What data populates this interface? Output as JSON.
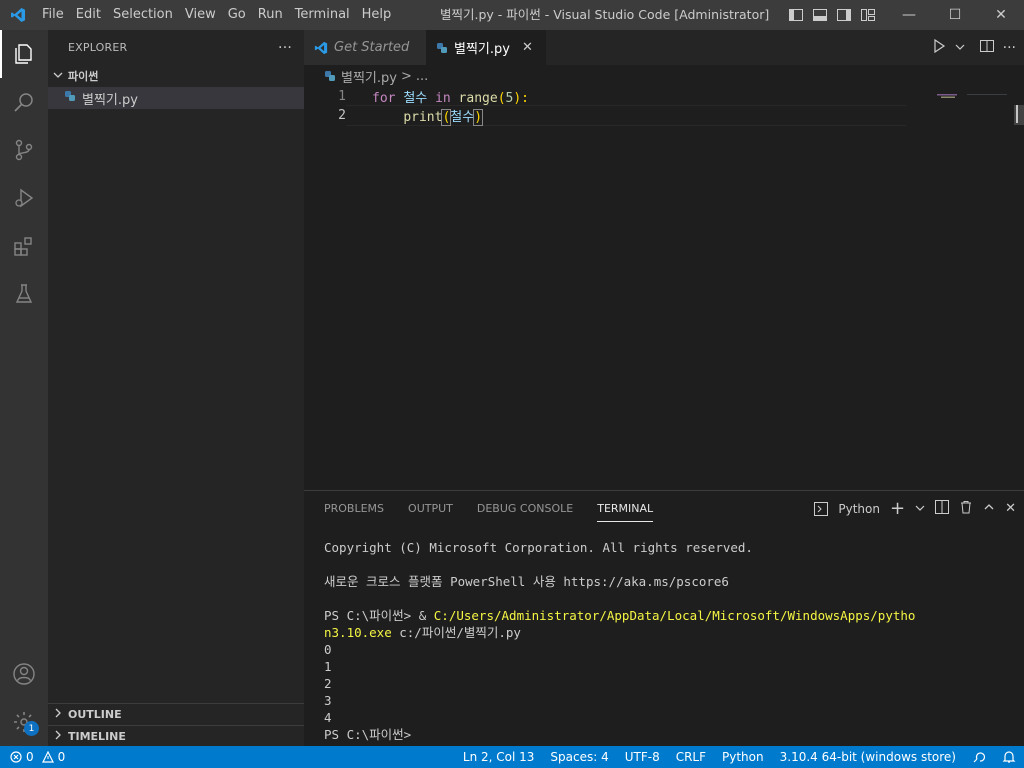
{
  "titlebar": {
    "menu": [
      "File",
      "Edit",
      "Selection",
      "View",
      "Go",
      "Run",
      "Terminal",
      "Help"
    ],
    "title": "별찍기.py - 파이썬 - Visual Studio Code [Administrator]"
  },
  "sidebar": {
    "header": "EXPLORER",
    "more": "···",
    "folder": "파이썬",
    "file": "별찍기.py",
    "outline": "OUTLINE",
    "timeline": "TIMELINE"
  },
  "tabs": [
    {
      "label": "Get Started",
      "active": false
    },
    {
      "label": "별찍기.py",
      "active": true,
      "close": "✕"
    }
  ],
  "breadcrumb": {
    "file": "별찍기.py",
    "sep": ">",
    "rest": "..."
  },
  "code": {
    "line_numbers": [
      "1",
      "2"
    ],
    "line1": {
      "kw1": "for",
      "var1": "철수",
      "kw2": "in",
      "fn": "range",
      "open": "(",
      "num": "5",
      "close": "):"
    },
    "line2": {
      "fn": "print",
      "open": "(",
      "var": "철수",
      "close": ")"
    }
  },
  "panel": {
    "tabs": [
      "PROBLEMS",
      "OUTPUT",
      "DEBUG CONSOLE",
      "TERMINAL"
    ],
    "active_tab": "TERMINAL",
    "shell": "Python",
    "terminal": {
      "l1": "Copyright (C) Microsoft Corporation. All rights reserved.",
      "l2": "새로운 크로스 플랫폼 PowerShell 사용 https://aka.ms/pscore6",
      "prompt": "PS C:\\파이썬> ",
      "amp": "& ",
      "cmd_a": "C:/Users/Administrator/AppData/Local/Microsoft/WindowsApps/pytho",
      "cmd_b": "n3.10.exe",
      "cmd_arg": " c:/파이썬/별찍기.py",
      "outputs": [
        "0",
        "1",
        "2",
        "3",
        "4"
      ],
      "final_prompt": "PS C:\\파이썬>"
    }
  },
  "statusbar": {
    "errors": "0",
    "warnings": "0",
    "position": "Ln 2, Col 13",
    "spaces": "Spaces: 4",
    "encoding": "UTF-8",
    "eol": "CRLF",
    "language": "Python",
    "interpreter": "3.10.4 64-bit (windows store)"
  },
  "activity_badge": "1",
  "colors": {
    "accent": "#007acc",
    "titlebar": "#3c3c3c",
    "activitybar": "#333333",
    "sidebar": "#252526",
    "editor": "#1e1e1e"
  }
}
